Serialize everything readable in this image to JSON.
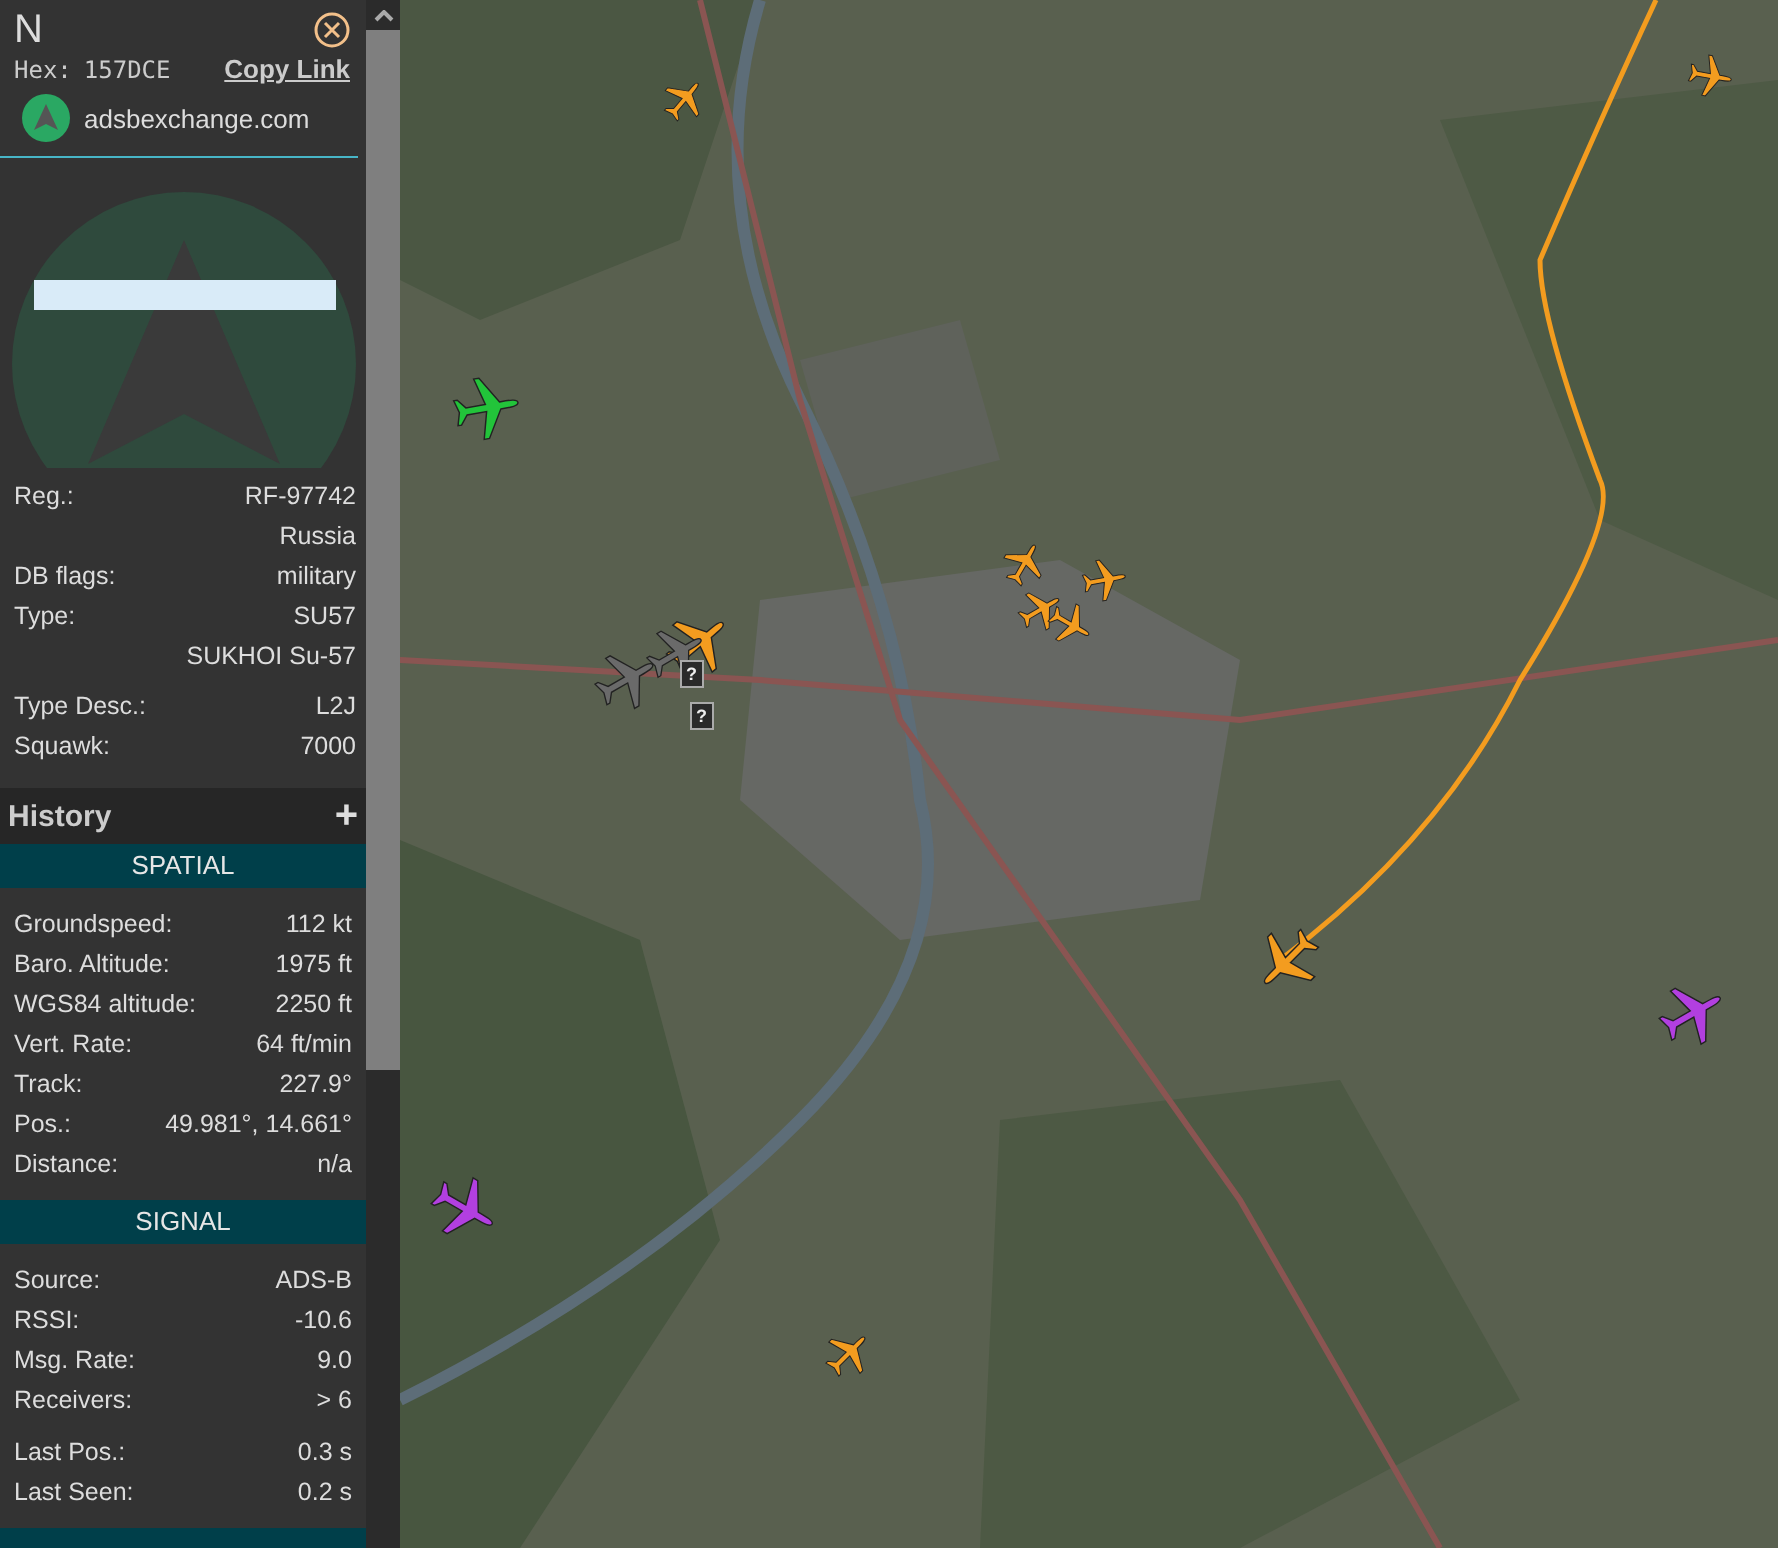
{
  "panel": {
    "title": "N",
    "hex_label": "Hex:",
    "hex": "157DCE",
    "copy_link": "Copy Link",
    "source_site": "adsbexchange.com",
    "details": [
      [
        {
          "label": "Reg.:",
          "value": "RF-97742"
        },
        {
          "value": "Russia"
        },
        {
          "label": "DB flags:",
          "value": "military"
        },
        {
          "label": "Type:",
          "value": "SU57"
        },
        {
          "value": "SUKHOI Su-57"
        }
      ],
      [
        {
          "label": "Type Desc.:",
          "value": "L2J"
        },
        {
          "label": "Squawk:",
          "value": "7000"
        }
      ]
    ],
    "history": {
      "title": "History",
      "toggle": "+"
    },
    "sections": [
      {
        "title": "SPATIAL",
        "groups": [
          [
            {
              "label": "Groundspeed:",
              "value": "112 kt"
            },
            {
              "label": "Baro. Altitude:",
              "value": "1975 ft"
            },
            {
              "label": "WGS84 altitude:",
              "value": "2250 ft"
            },
            {
              "label": "Vert. Rate:",
              "value": "64 ft/min"
            },
            {
              "label": "Track:",
              "value": "227.9°"
            },
            {
              "label": "Pos.:",
              "value": "49.981°, 14.661°"
            },
            {
              "label": "Distance:",
              "value": "n/a"
            }
          ]
        ]
      },
      {
        "title": "SIGNAL",
        "groups": [
          [
            {
              "label": "Source:",
              "value": "ADS-B"
            },
            {
              "label": "RSSI:",
              "value": "-10.6"
            },
            {
              "label": "Msg. Rate:",
              "value": "9.0"
            },
            {
              "label": "Receivers:",
              "value": "> 6"
            }
          ],
          [
            {
              "label": "Last Pos.:",
              "value": "0.3 s"
            },
            {
              "label": "Last Seen:",
              "value": "0.2 s"
            }
          ]
        ]
      }
    ]
  },
  "map": {
    "aircraft": [
      {
        "color": "#f39c1f"
      },
      {
        "color": "#f39c1f"
      },
      {
        "color": "#f39c1f"
      },
      {
        "color": "#f39c1f"
      },
      {
        "color": "#f39c1f"
      },
      {
        "color": "#f39c1f"
      },
      {
        "color": "#f39c1f"
      },
      {
        "color": "#f39c1f"
      },
      {
        "color": "#f39c1f"
      },
      {
        "color": "#22c43a"
      },
      {
        "color": "#b23fe0"
      },
      {
        "color": "#b23fe0"
      },
      {
        "color": "#6a6a6a"
      },
      {
        "color": "#6a6a6a"
      }
    ],
    "tags": [
      "?",
      "?"
    ]
  }
}
